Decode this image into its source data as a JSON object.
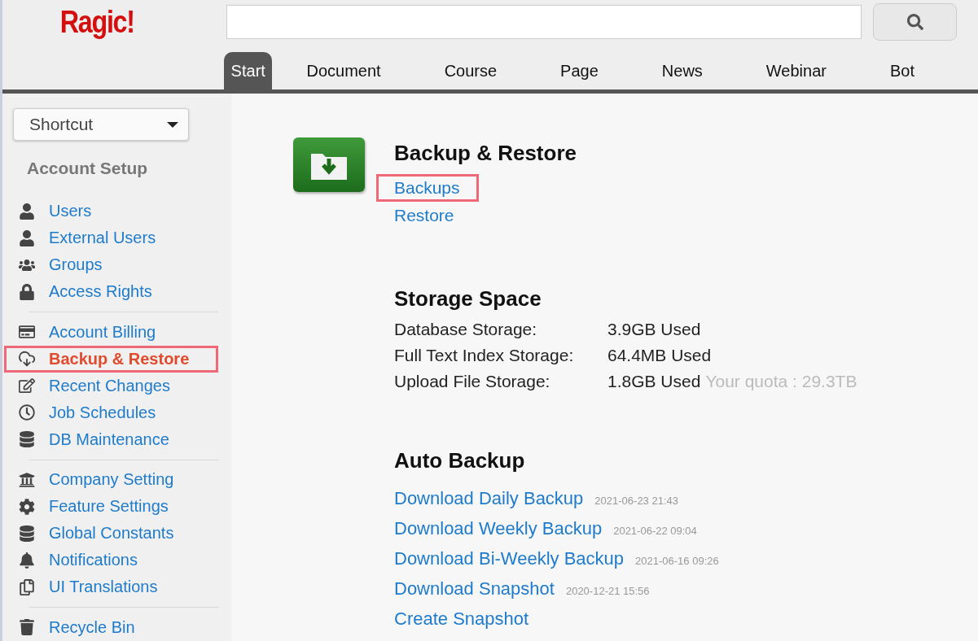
{
  "logo": "Ragic!",
  "tabs": [
    {
      "label": "Start",
      "selected": true
    },
    {
      "label": "Document",
      "selected": false
    },
    {
      "label": "Course",
      "selected": false
    },
    {
      "label": "Page",
      "selected": false
    },
    {
      "label": "News",
      "selected": false
    },
    {
      "label": "Webinar",
      "selected": false
    },
    {
      "label": "Bot",
      "selected": false
    }
  ],
  "sidebar": {
    "shortcut": "Shortcut",
    "heading": "Account Setup",
    "groups": [
      {
        "items": [
          {
            "label": "Users",
            "selected": false,
            "highlighted": false
          },
          {
            "label": "External Users",
            "selected": false,
            "highlighted": false
          },
          {
            "label": "Groups",
            "selected": false,
            "highlighted": false
          },
          {
            "label": "Access Rights",
            "selected": false,
            "highlighted": false
          }
        ]
      },
      {
        "items": [
          {
            "label": "Account Billing",
            "selected": false,
            "highlighted": false
          },
          {
            "label": "Backup & Restore",
            "selected": true,
            "highlighted": true
          },
          {
            "label": "Recent Changes",
            "selected": false,
            "highlighted": false
          },
          {
            "label": "Job Schedules",
            "selected": false,
            "highlighted": false
          },
          {
            "label": "DB Maintenance",
            "selected": false,
            "highlighted": false
          }
        ]
      },
      {
        "items": [
          {
            "label": "Company Setting",
            "selected": false,
            "highlighted": false
          },
          {
            "label": "Feature Settings",
            "selected": false,
            "highlighted": false
          },
          {
            "label": "Global Constants",
            "selected": false,
            "highlighted": false
          },
          {
            "label": "Notifications",
            "selected": false,
            "highlighted": false
          },
          {
            "label": "UI Translations",
            "selected": false,
            "highlighted": false
          }
        ]
      },
      {
        "items": [
          {
            "label": "Recycle Bin",
            "selected": false,
            "highlighted": false
          }
        ]
      }
    ]
  },
  "backup": {
    "title": "Backup & Restore",
    "links": [
      {
        "label": "Backups",
        "highlighted": true
      },
      {
        "label": "Restore",
        "highlighted": false
      }
    ]
  },
  "storage": {
    "title": "Storage Space",
    "rows": [
      {
        "label": "Database Storage:",
        "value": "3.9GB Used"
      },
      {
        "label": "Full Text Index Storage:",
        "value": "64.4MB Used"
      },
      {
        "label": "Upload File Storage:",
        "value": "1.8GB Used",
        "note": "Your quota : 29.3TB"
      }
    ]
  },
  "auto_backup": {
    "title": "Auto Backup",
    "links": [
      {
        "label": "Download Daily Backup",
        "time": "2021-06-23 21:43"
      },
      {
        "label": "Download Weekly Backup",
        "time": "2021-06-22 09:04"
      },
      {
        "label": "Download Bi-Weekly Backup",
        "time": "2021-06-16 09:26"
      },
      {
        "label": "Download Snapshot",
        "time": "2020-12-21 15:56"
      },
      {
        "label": "Create Snapshot"
      }
    ]
  }
}
